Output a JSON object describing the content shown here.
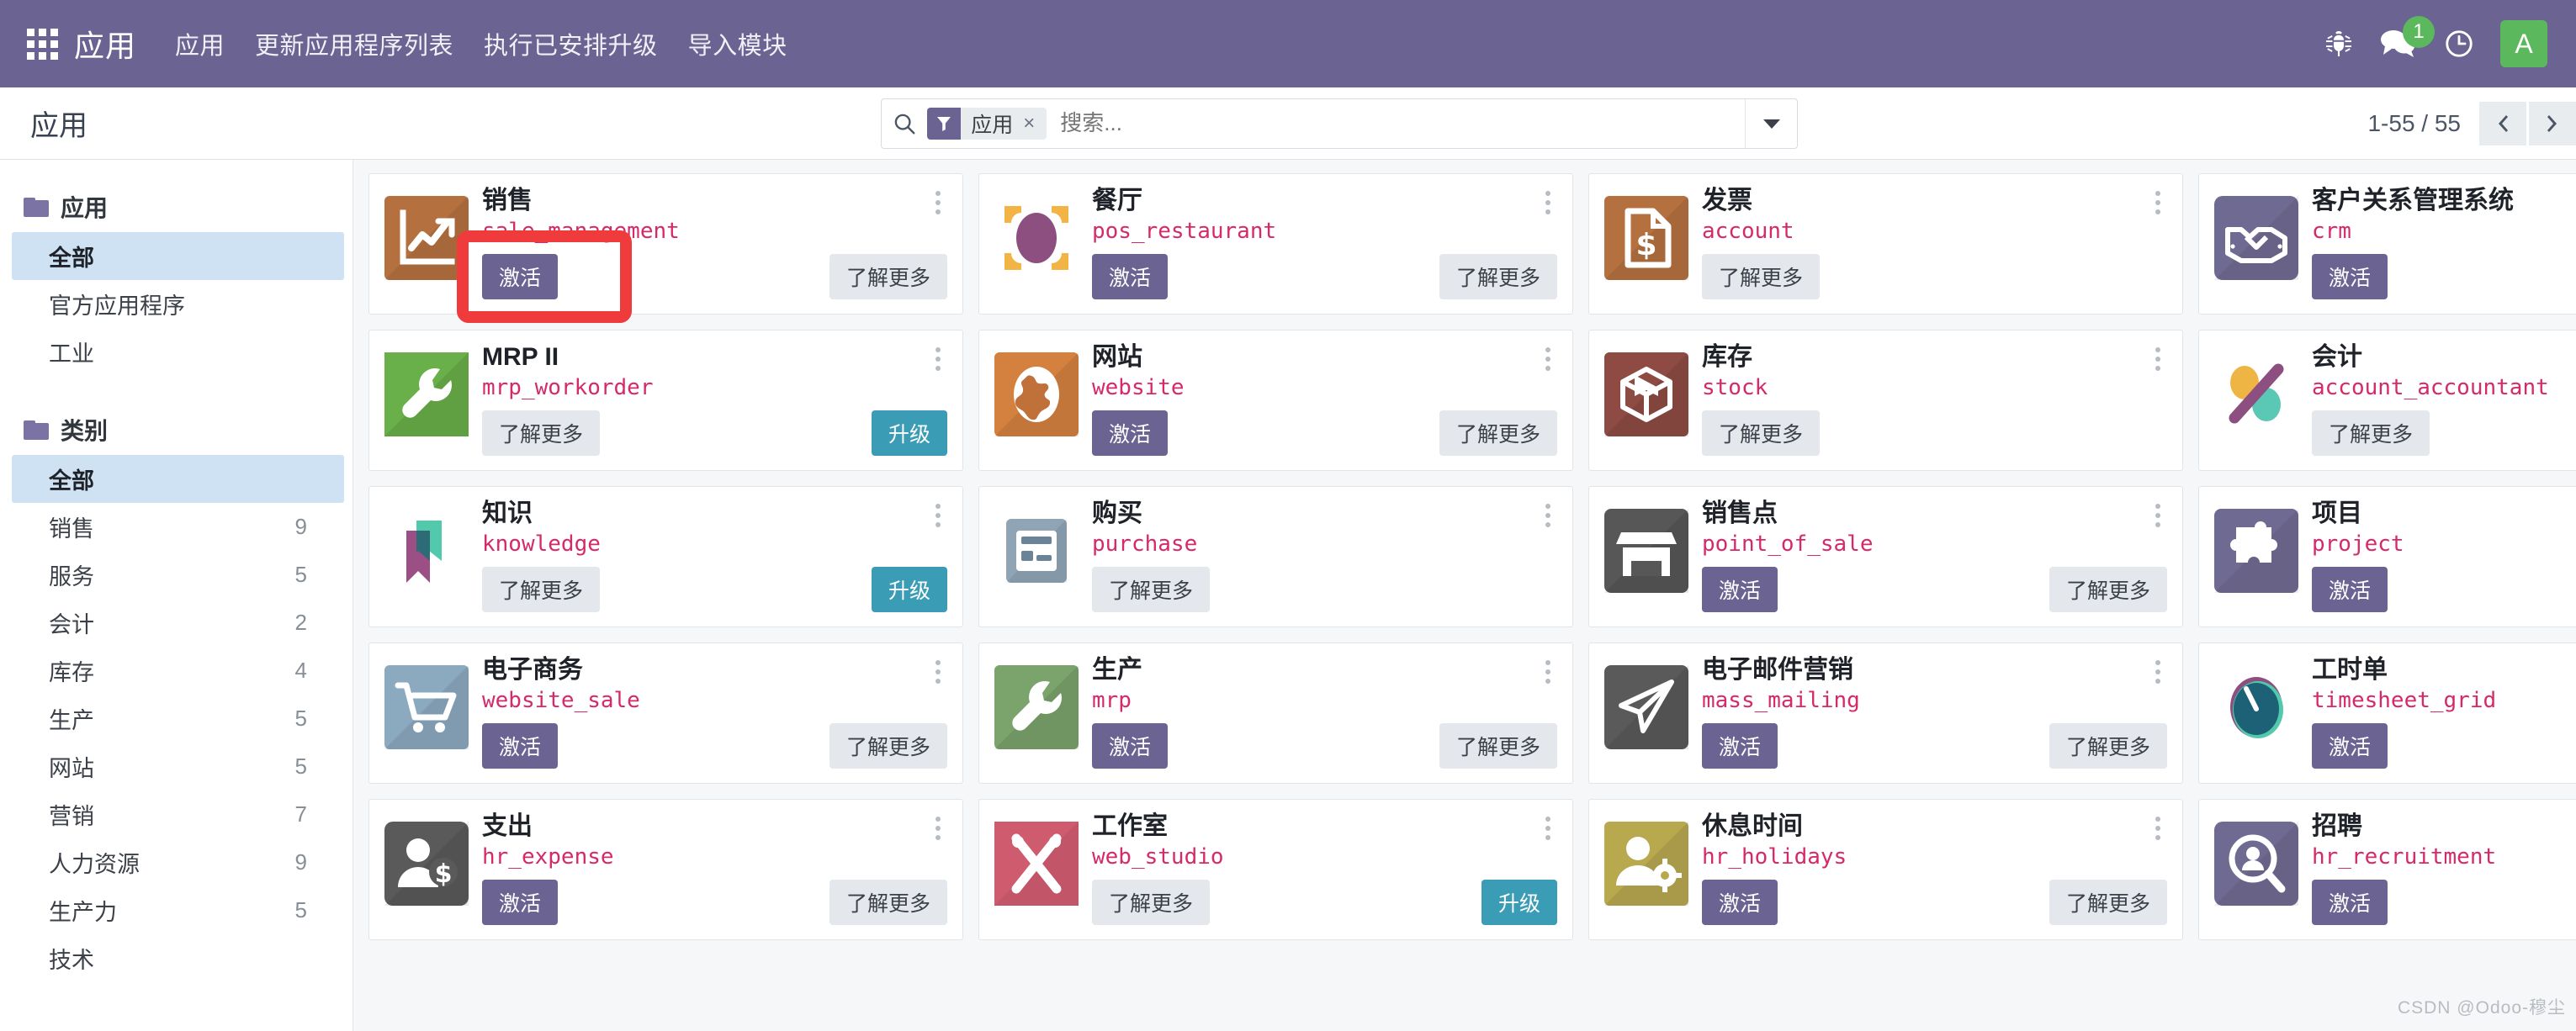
{
  "navbar": {
    "apps_grid_icon": "apps-grid-icon",
    "brand": "应用",
    "menu": [
      {
        "label": "应用"
      },
      {
        "label": "更新应用程序列表"
      },
      {
        "label": "执行已安排升级"
      },
      {
        "label": "导入模块"
      }
    ],
    "bug_icon": "bug-icon",
    "messages_icon": "messages-icon",
    "messages_count": "1",
    "activity_icon": "clock-icon",
    "avatar_initial": "A",
    "accent_color": "#6b6392",
    "badge_color": "#5cb85c"
  },
  "control_panel": {
    "title": "应用",
    "search": {
      "search_icon": "search-icon",
      "facet_icon": "filter-icon",
      "facet_label": "应用",
      "facet_remove": "×",
      "placeholder": "搜索...",
      "value": "",
      "toggle_icon": "chevron-down-icon"
    },
    "pager": {
      "value": "1-55 / 55",
      "prev_icon": "chevron-left-icon",
      "next_icon": "chevron-right-icon"
    }
  },
  "sidebar": {
    "sections": [
      {
        "title": "应用",
        "folder_icon": "folder-icon",
        "items": [
          {
            "label": "全部",
            "count": "",
            "selected": true
          },
          {
            "label": "官方应用程序",
            "count": "",
            "selected": false
          },
          {
            "label": "工业",
            "count": "",
            "selected": false
          }
        ]
      },
      {
        "title": "类别",
        "folder_icon": "folder-icon",
        "items": [
          {
            "label": "全部",
            "count": "",
            "selected": true
          },
          {
            "label": "销售",
            "count": "9",
            "selected": false
          },
          {
            "label": "服务",
            "count": "5",
            "selected": false
          },
          {
            "label": "会计",
            "count": "2",
            "selected": false
          },
          {
            "label": "库存",
            "count": "4",
            "selected": false
          },
          {
            "label": "生产",
            "count": "5",
            "selected": false
          },
          {
            "label": "网站",
            "count": "5",
            "selected": false
          },
          {
            "label": "营销",
            "count": "7",
            "selected": false
          },
          {
            "label": "人力资源",
            "count": "9",
            "selected": false
          },
          {
            "label": "生产力",
            "count": "5",
            "selected": false
          },
          {
            "label": "技术",
            "count": "",
            "selected": false
          }
        ]
      }
    ]
  },
  "buttons": {
    "activate": "激活",
    "learn_more": "了解更多",
    "upgrade": "升级"
  },
  "kanban": {
    "cards": [
      {
        "name": "销售",
        "tech": "sale_management",
        "icon": "sales-chart-icon",
        "activate": true,
        "learn_more": true,
        "upgrade": false,
        "highlighted": true
      },
      {
        "name": "餐厅",
        "tech": "pos_restaurant",
        "icon": "restaurant-icon",
        "activate": true,
        "learn_more": true,
        "upgrade": false,
        "highlighted": false
      },
      {
        "name": "发票",
        "tech": "account",
        "icon": "invoice-icon",
        "activate": false,
        "learn_more": true,
        "upgrade": false,
        "highlighted": false
      },
      {
        "name": "客户关系管理系统",
        "tech": "crm",
        "icon": "handshake-icon",
        "activate": true,
        "learn_more": false,
        "upgrade": false,
        "highlighted": false
      },
      {
        "name": "MRP II",
        "tech": "mrp_workorder",
        "icon": "wrench-green-icon",
        "activate": false,
        "learn_more": true,
        "upgrade": true,
        "highlighted": false
      },
      {
        "name": "网站",
        "tech": "website",
        "icon": "globe-icon",
        "activate": true,
        "learn_more": true,
        "upgrade": false,
        "highlighted": false
      },
      {
        "name": "库存",
        "tech": "stock",
        "icon": "box-icon",
        "activate": false,
        "learn_more": true,
        "upgrade": false,
        "highlighted": false
      },
      {
        "name": "会计",
        "tech": "account_accountant",
        "icon": "accounting-x-icon",
        "activate": false,
        "learn_more": true,
        "upgrade": false,
        "highlighted": false
      },
      {
        "name": "知识",
        "tech": "knowledge",
        "icon": "bookmark-icon",
        "activate": false,
        "learn_more": true,
        "upgrade": true,
        "highlighted": false
      },
      {
        "name": "购买",
        "tech": "purchase",
        "icon": "receipt-icon",
        "activate": false,
        "learn_more": true,
        "upgrade": false,
        "highlighted": false
      },
      {
        "name": "销售点",
        "tech": "point_of_sale",
        "icon": "shop-icon",
        "activate": true,
        "learn_more": true,
        "upgrade": false,
        "highlighted": false
      },
      {
        "name": "项目",
        "tech": "project",
        "icon": "puzzle-icon",
        "activate": true,
        "learn_more": false,
        "upgrade": false,
        "highlighted": false
      },
      {
        "name": "电子商务",
        "tech": "website_sale",
        "icon": "cart-icon",
        "activate": true,
        "learn_more": true,
        "upgrade": false,
        "highlighted": false
      },
      {
        "name": "生产",
        "tech": "mrp",
        "icon": "wrench-icon",
        "activate": true,
        "learn_more": true,
        "upgrade": false,
        "highlighted": false
      },
      {
        "name": "电子邮件营销",
        "tech": "mass_mailing",
        "icon": "paperplane-icon",
        "activate": true,
        "learn_more": true,
        "upgrade": false,
        "highlighted": false
      },
      {
        "name": "工时单",
        "tech": "timesheet_grid",
        "icon": "gauge-icon",
        "activate": true,
        "learn_more": false,
        "upgrade": false,
        "highlighted": false
      },
      {
        "name": "支出",
        "tech": "hr_expense",
        "icon": "expense-icon",
        "activate": true,
        "learn_more": true,
        "upgrade": false,
        "highlighted": false
      },
      {
        "name": "工作室",
        "tech": "web_studio",
        "icon": "studio-icon",
        "activate": false,
        "learn_more": true,
        "upgrade": true,
        "highlighted": false
      },
      {
        "name": "休息时间",
        "tech": "hr_holidays",
        "icon": "timeoff-icon",
        "activate": true,
        "learn_more": true,
        "upgrade": false,
        "highlighted": false
      },
      {
        "name": "招聘",
        "tech": "hr_recruitment",
        "icon": "recruitment-icon",
        "activate": true,
        "learn_more": false,
        "upgrade": false,
        "highlighted": false
      }
    ]
  },
  "watermark": "CSDN @Odoo-穆尘"
}
